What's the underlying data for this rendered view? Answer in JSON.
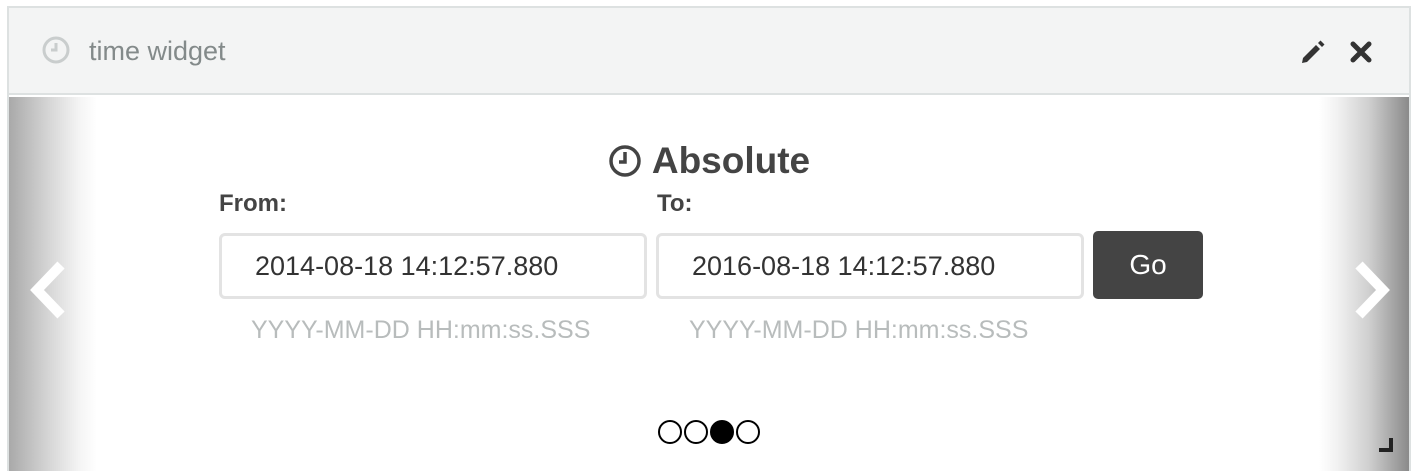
{
  "header": {
    "title": "time widget",
    "icons": {
      "clock": "clock-icon",
      "edit": "pencil-icon",
      "close": "close-icon"
    }
  },
  "main": {
    "mode_title": "Absolute",
    "mode_icon": "clock-icon",
    "from": {
      "label": "From:",
      "value": "2014-08-18 14:12:57.880",
      "hint": "YYYY-MM-DD HH:mm:ss.SSS"
    },
    "to": {
      "label": "To:",
      "value": "2016-08-18 14:12:57.880",
      "hint": "YYYY-MM-DD HH:mm:ss.SSS"
    },
    "go_label": "Go",
    "carousel": {
      "prev_icon": "chevron-left-icon",
      "next_icon": "chevron-right-icon",
      "page_count": 4,
      "active_index": 2
    }
  },
  "colors": {
    "header_bg": "#f3f4f4",
    "border": "#dde1e1",
    "button_bg": "#444444",
    "hint_text": "#b8bcbc",
    "header_text": "#838a8a"
  }
}
